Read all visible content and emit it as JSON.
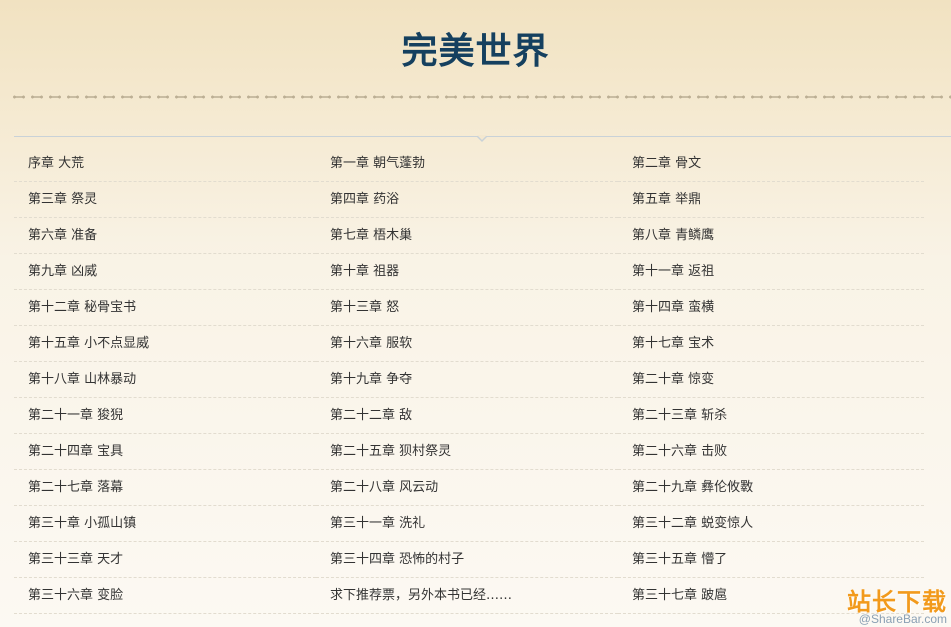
{
  "page": {
    "title": "完美世界"
  },
  "chapters": [
    "序章 大荒",
    "第一章 朝气蓬勃",
    "第二章 骨文",
    "第三章 祭灵",
    "第四章 药浴",
    "第五章 举鼎",
    "第六章 准备",
    "第七章 梧木巢",
    "第八章 青鳞鹰",
    "第九章 凶威",
    "第十章 祖器",
    "第十一章 返祖",
    "第十二章 秘骨宝书",
    "第十三章 怒",
    "第十四章 蛮横",
    "第十五章 小不点显威",
    "第十六章 服软",
    "第十七章 宝术",
    "第十八章 山林暴动",
    "第十九章 争夺",
    "第二十章 惊变",
    "第二十一章 狻猊",
    "第二十二章 敌",
    "第二十三章 斩杀",
    "第二十四章 宝具",
    "第二十五章 狈村祭灵",
    "第二十六章 击败",
    "第二十七章 落幕",
    "第二十八章 风云动",
    "第二十九章 彝伦攸斁",
    "第三十章 小孤山镇",
    "第三十一章 洗礼",
    "第三十二章 蜕变惊人",
    "第三十三章 天才",
    "第三十四章 恐怖的村子",
    "第三十五章 懵了",
    "第三十六章 变脸",
    "求下推荐票，另外本书已经……",
    "第三十七章 跛扈"
  ],
  "watermark": {
    "main": "站长下载",
    "sub": "@ShareBar.com"
  }
}
